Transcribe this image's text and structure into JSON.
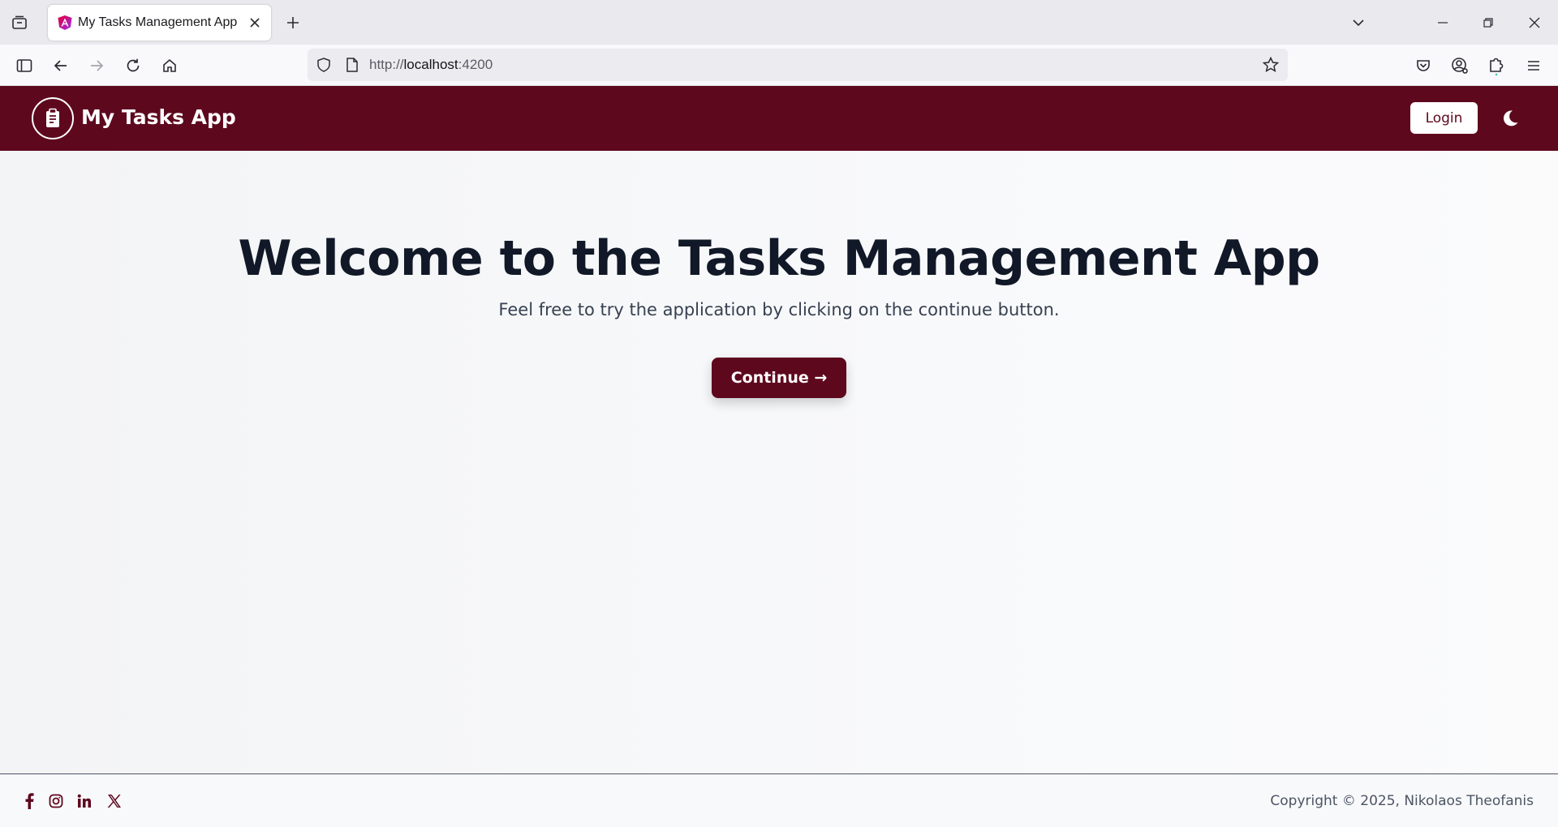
{
  "browser": {
    "tab": {
      "title": "My Tasks Management App",
      "favicon": "angular-icon"
    },
    "url": {
      "scheme": "http://",
      "host": "localhost",
      "port": ":4200"
    }
  },
  "header": {
    "brand_title": "My Tasks App",
    "logo_icon": "clipboard-icon",
    "login_label": "Login",
    "theme_icon": "moon-icon"
  },
  "hero": {
    "title": "Welcome to the Tasks Management App",
    "subtitle": "Feel free to try the application by clicking on the continue button.",
    "continue_label": "Continue →"
  },
  "footer": {
    "social_icons": [
      "facebook-icon",
      "instagram-icon",
      "linkedin-icon",
      "x-icon"
    ],
    "copyright": "Copyright © 2025, Nikolaos Theofanis"
  },
  "colors": {
    "brand": "#5e081e",
    "heading": "#111827",
    "text": "#374151",
    "background": "#f8f9fb"
  }
}
